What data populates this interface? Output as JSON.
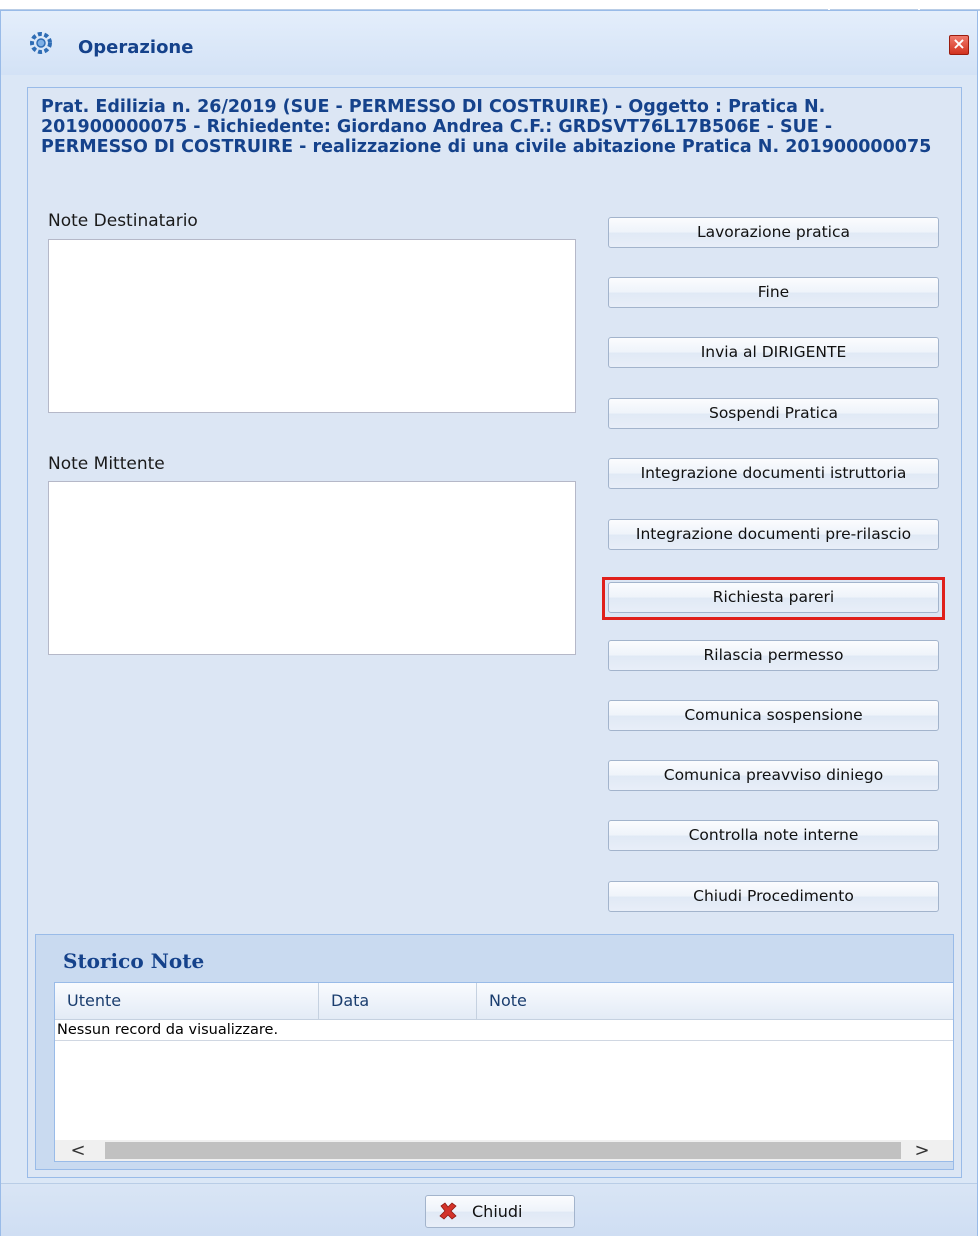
{
  "window": {
    "title": "Operazione"
  },
  "header": {
    "text": "Prat. Edilizia n. 26/2019 (SUE - PERMESSO DI COSTRUIRE) - Oggetto : Pratica N. 201900000075 - Richiedente: Giordano Andrea C.F.: GRDSVT76L17B506E - SUE - PERMESSO DI COSTRUIRE - realizzazione di una civile abitazione Pratica N. 201900000075"
  },
  "notes": {
    "destinatario_label": "Note Destinatario",
    "mittente_label": "Note Mittente"
  },
  "actions": [
    {
      "label": "Lavorazione pratica"
    },
    {
      "label": "Fine"
    },
    {
      "label": "Invia al DIRIGENTE"
    },
    {
      "label": "Sospendi Pratica"
    },
    {
      "label": "Integrazione documenti istruttoria"
    },
    {
      "label": "Integrazione documenti pre-rilascio"
    },
    {
      "label": "Richiesta pareri"
    },
    {
      "label": "Rilascia permesso"
    },
    {
      "label": "Comunica sospensione"
    },
    {
      "label": "Comunica preavviso diniego"
    },
    {
      "label": "Controlla note interne"
    },
    {
      "label": "Chiudi Procedimento"
    }
  ],
  "storico": {
    "title": "Storico Note",
    "columns": [
      "Utente",
      "Data",
      "Note"
    ],
    "empty_message": "Nessun record da visualizzare.",
    "scroll_left": "<",
    "scroll_right": ">"
  },
  "footer": {
    "close_label": "Chiudi"
  },
  "colors": {
    "title": "#15428b",
    "highlight": "#e0201b",
    "close": "#d2321f"
  }
}
